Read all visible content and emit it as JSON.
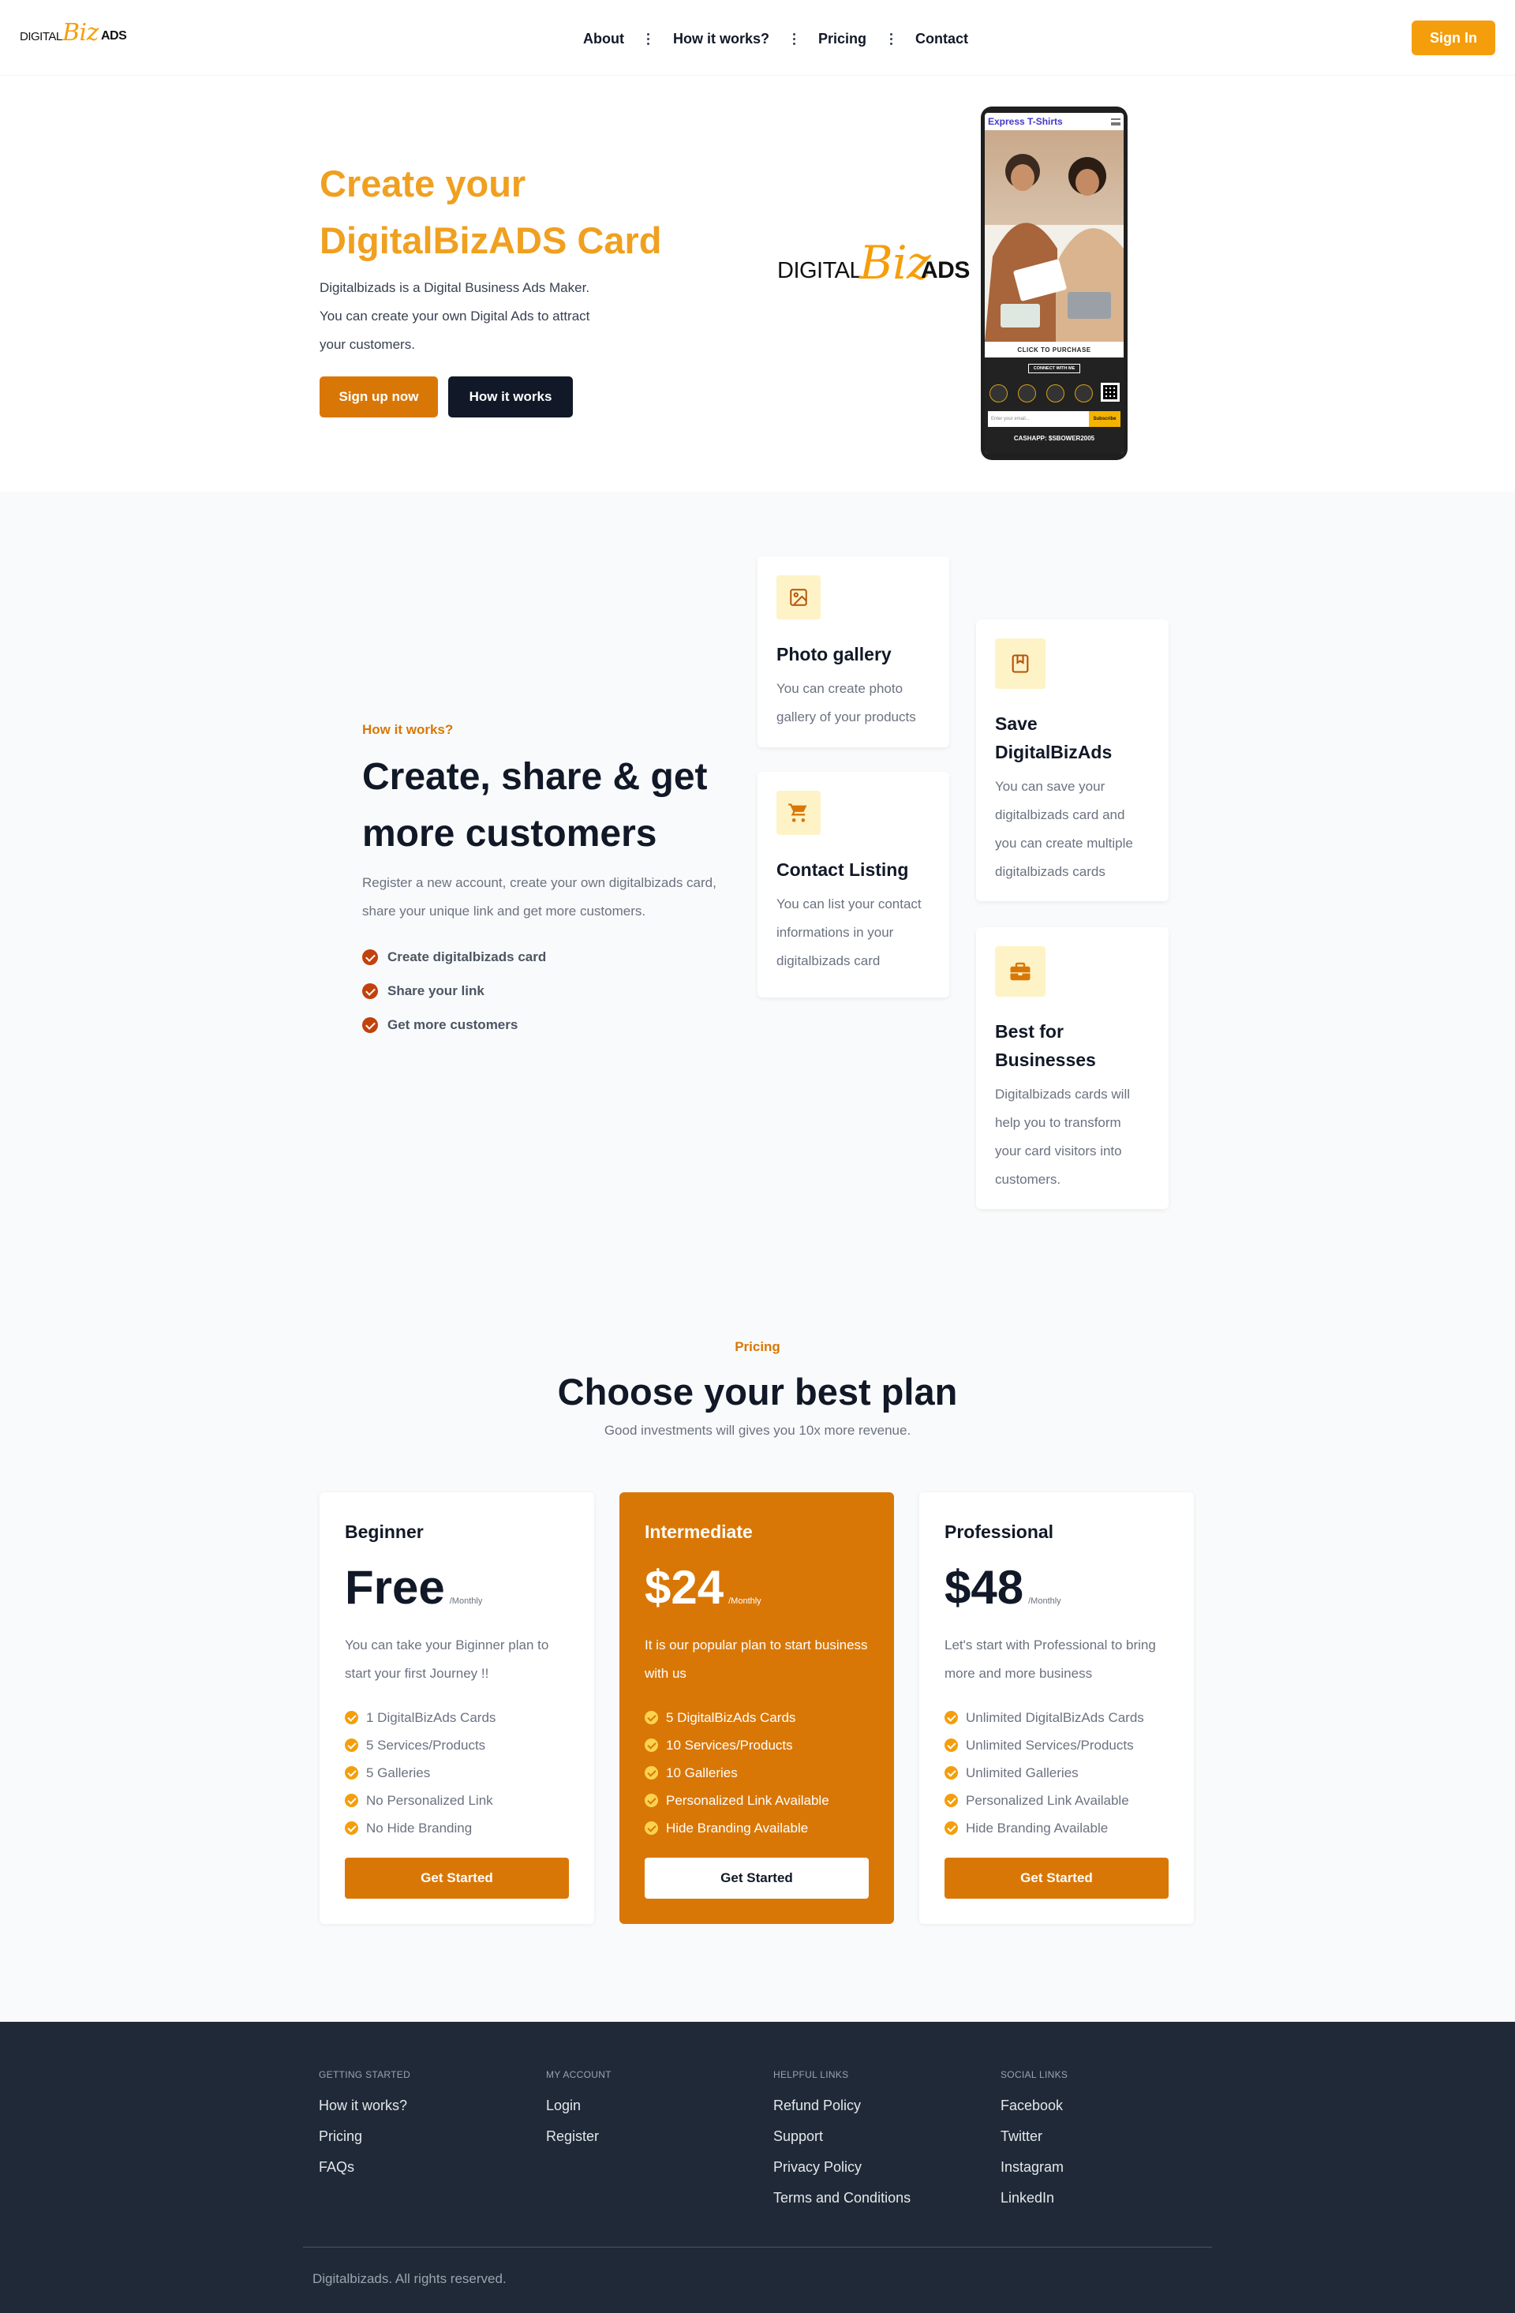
{
  "header": {
    "logo": {
      "word1": "DIGITAL",
      "word2": "Biz",
      "word3": "ADS"
    },
    "nav": [
      "About",
      "How it works?",
      "Pricing",
      "Contact"
    ],
    "signin": "Sign In"
  },
  "hero": {
    "title_line1": "Create your",
    "title_line2": "DigitalBizADS Card",
    "desc_line1": "Digitalbizads is a Digital Business Ads Maker.",
    "desc_line2": "You can create your own Digital Ads to attract",
    "desc_line3": "your customers.",
    "signup": "Sign up now",
    "how": "How it works",
    "phone": {
      "shop_title": "Express T-Shirts",
      "click_purchase": "CLICK TO PURCHASE",
      "connect": "CONNECT WITH ME",
      "email_placeholder": "Enter your email...",
      "subscribe": "Subscribe",
      "cashapp": "CASHAPP: $SBOWER2005"
    }
  },
  "how": {
    "eyebrow": "How it works?",
    "title": "Create, share & get more customers",
    "desc": "Register a new account, create your own digitalbizads card, share your unique link and get more customers.",
    "checks": [
      "Create digitalbizads card",
      "Share your link",
      "Get more customers"
    ],
    "cards": [
      {
        "title": "Photo gallery",
        "desc": "You can create photo gallery of your products",
        "icon": "image-icon"
      },
      {
        "title": "Contact Listing",
        "desc": "You can list your contact informations in your digitalbizads card",
        "icon": "cart-icon"
      },
      {
        "title": "Save DigitalBizAds",
        "desc": "You can save your digitalbizads card and you can create multiple digitalbizads cards",
        "icon": "bookmark-icon"
      },
      {
        "title": "Best for Businesses",
        "desc": "Digitalbizads cards will help you to transform your card visitors into customers.",
        "icon": "briefcase-icon"
      }
    ]
  },
  "pricing": {
    "eyebrow": "Pricing",
    "title": "Choose your best plan",
    "subtitle": "Good investments will gives you 10x more revenue.",
    "plans": [
      {
        "name": "Beginner",
        "price": "Free",
        "period": "/Monthly",
        "desc": "You can take your Biginner plan to start your first Journey !!",
        "features": [
          "1 DigitalBizAds Cards",
          "5 Services/Products",
          "5 Galleries",
          "No Personalized Link",
          "No Hide Branding"
        ],
        "cta": "Get Started"
      },
      {
        "name": "Intermediate",
        "price": "$24",
        "period": "/Monthly",
        "desc": "It is our popular plan to start business with us",
        "features": [
          "5 DigitalBizAds Cards",
          "10 Services/Products",
          "10 Galleries",
          "Personalized Link Available",
          "Hide Branding Available"
        ],
        "cta": "Get Started"
      },
      {
        "name": "Professional",
        "price": "$48",
        "period": "/Monthly",
        "desc": "Let's start with Professional to bring more and more business",
        "features": [
          "Unlimited DigitalBizAds Cards",
          "Unlimited Services/Products",
          "Unlimited Galleries",
          "Personalized Link Available",
          "Hide Branding Available"
        ],
        "cta": "Get Started"
      }
    ]
  },
  "footer": {
    "cols": [
      {
        "heading": "GETTING STARTED",
        "links": [
          "How it works?",
          "Pricing",
          "FAQs"
        ]
      },
      {
        "heading": "MY ACCOUNT",
        "links": [
          "Login",
          "Register"
        ]
      },
      {
        "heading": "HELPFUL LINKS",
        "links": [
          "Refund Policy",
          "Support",
          "Privacy Policy",
          "Terms and Conditions"
        ]
      },
      {
        "heading": "SOCIAL LINKS",
        "links": [
          "Facebook",
          "Twitter",
          "Instagram",
          "LinkedIn"
        ]
      }
    ],
    "copyright": "Digitalbizads. All rights reserved."
  },
  "colors": {
    "accent": "#d97706",
    "accent_light": "#f59e0b",
    "dark": "#111827",
    "footer_bg": "#1f2937"
  }
}
